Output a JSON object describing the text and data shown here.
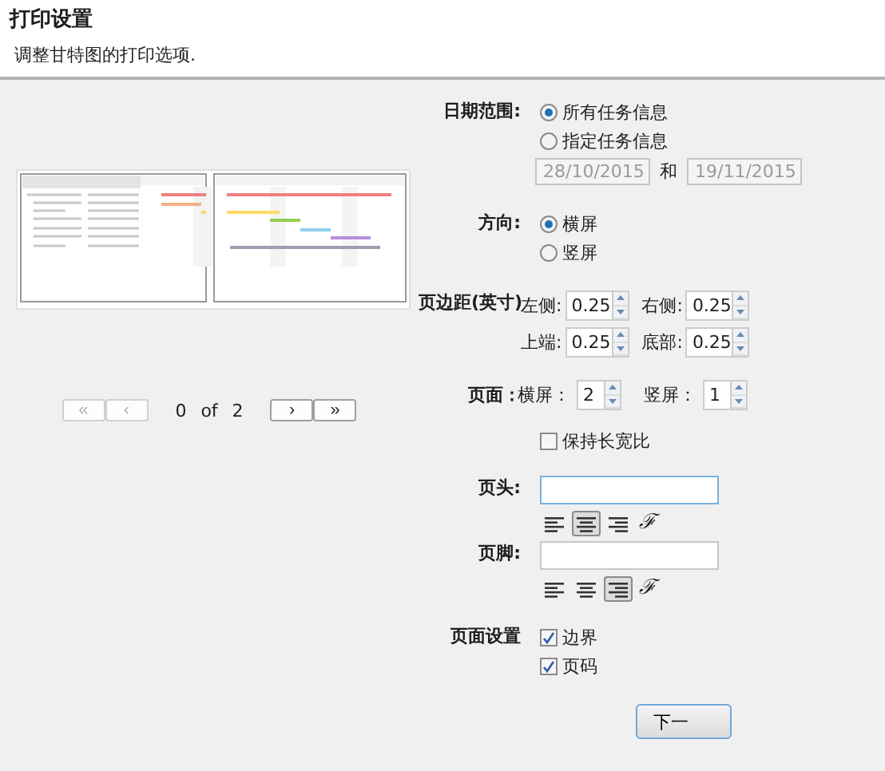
{
  "header": {
    "title": "打印设置",
    "subtitle": "调整甘特图的打印选项."
  },
  "pager": {
    "first": {
      "label": "«",
      "disabled": true
    },
    "prev": {
      "label": "‹",
      "disabled": true
    },
    "current": "0",
    "of": "of",
    "total": "2",
    "next": {
      "label": "›",
      "disabled": false
    },
    "last": {
      "label": "»",
      "disabled": false
    }
  },
  "date_range": {
    "label": "日期范围:",
    "options": [
      {
        "label": "所有任务信息",
        "selected": true
      },
      {
        "label": "指定任务信息",
        "selected": false
      }
    ],
    "from": "28/10/2015",
    "and": "和",
    "to": "19/11/2015",
    "disabled": true
  },
  "orientation": {
    "label": "方向:",
    "options": [
      {
        "label": "横屏",
        "selected": true
      },
      {
        "label": "竖屏",
        "selected": false
      }
    ]
  },
  "margins": {
    "label": "页边距(英寸)",
    "fields": [
      {
        "label": "左侧:",
        "value": "0.25"
      },
      {
        "label": "右侧:",
        "value": "0.25"
      },
      {
        "label": "上端:",
        "value": "0.25"
      },
      {
        "label": "底部:",
        "value": "0.25"
      }
    ]
  },
  "pages": {
    "label": "页面：",
    "fields": [
      {
        "label": "横屏：",
        "value": "2"
      },
      {
        "label": "竖屏：",
        "value": "1"
      }
    ]
  },
  "keep_ratio": {
    "label": "保持长宽比",
    "checked": false
  },
  "page_header": {
    "label": "页头:",
    "focused": true,
    "align": [
      {
        "kind": "left",
        "selected": false
      },
      {
        "kind": "center",
        "selected": true
      },
      {
        "kind": "right",
        "selected": false
      }
    ],
    "font_button": "ℱ"
  },
  "page_footer": {
    "label": "页脚:",
    "focused": false,
    "align": [
      {
        "kind": "left",
        "selected": false
      },
      {
        "kind": "center",
        "selected": false
      },
      {
        "kind": "right",
        "selected": true
      }
    ],
    "font_button": "ℱ"
  },
  "page_settings": {
    "label": "页面设置",
    "options": [
      {
        "label": "边界",
        "checked": true
      },
      {
        "label": "页码",
        "checked": true
      }
    ]
  },
  "next_button": "下一"
}
